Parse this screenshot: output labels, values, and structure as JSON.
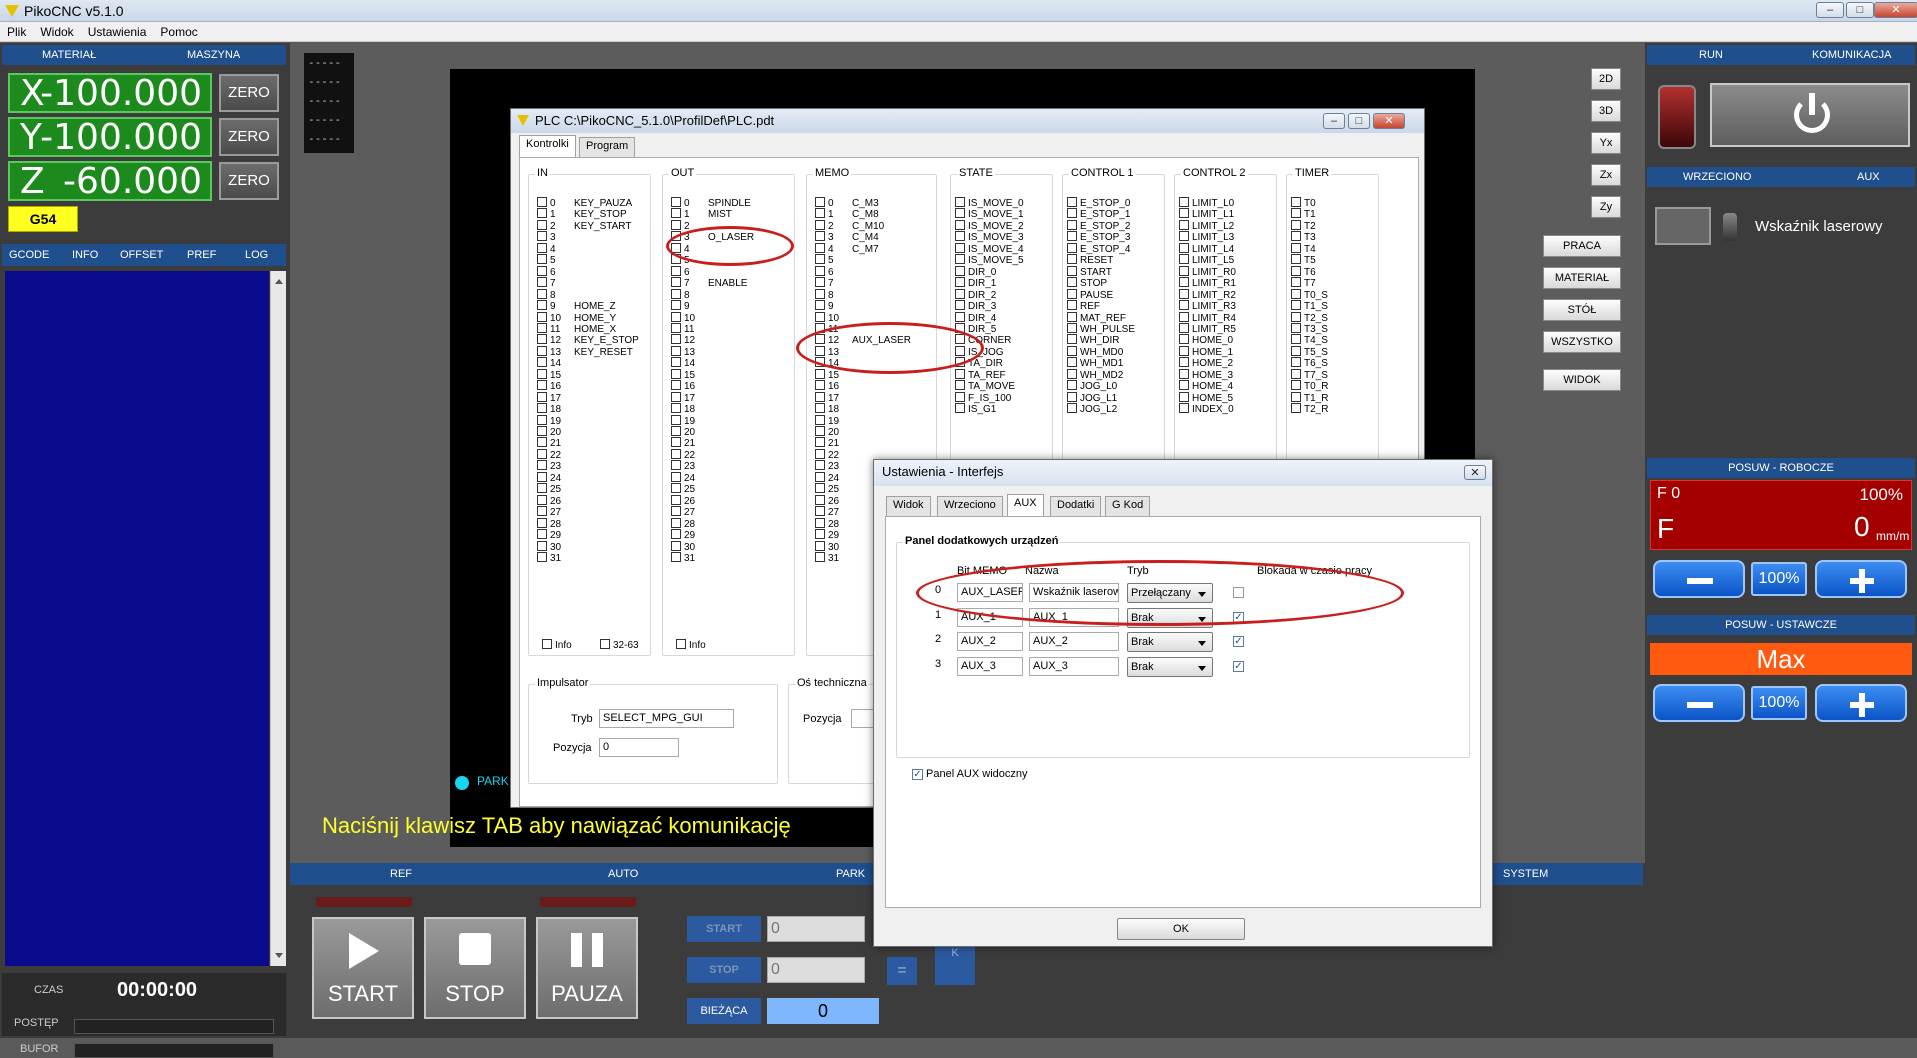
{
  "app": {
    "title": "PikoCNC v5.1.0",
    "menu": [
      "Plik",
      "Widok",
      "Ustawienia",
      "Pomoc"
    ]
  },
  "dro": {
    "hdr_left": "MATERIAŁ",
    "hdr_right": "MASZYNA",
    "axes": [
      {
        "axis": "X",
        "value": "-100.000"
      },
      {
        "axis": "Y",
        "value": "-100.000"
      },
      {
        "axis": "Z",
        "value": "-60.000"
      }
    ],
    "zero_label": "ZERO",
    "wcs": "G54"
  },
  "left_tabs": [
    "GCODE",
    "INFO",
    "OFFSET",
    "PREF",
    "LOG"
  ],
  "status": {
    "czas_label": "CZAS",
    "czas": "00:00:00",
    "postep_label": "POSTĘP",
    "bufor_label": "BUFOR"
  },
  "viewer": {
    "dashes": [
      "-----",
      "-----",
      "-----",
      "-----",
      "-----"
    ],
    "park": "PARK",
    "message": "Naciśnij klawisz TAB aby nawiązać komunikację"
  },
  "view_buttons": [
    "2D",
    "3D",
    "Yx",
    "Zx",
    "Zy"
  ],
  "side_buttons": [
    "PRACA",
    "MATERIAŁ",
    "STÓŁ",
    "WSZYSTKO",
    "WIDOK"
  ],
  "bottom_bar": {
    "ref": "REF",
    "auto": "AUTO",
    "park": "PARK",
    "system": "SYSTEM",
    "start": "START",
    "stop": "STOP",
    "pauza": "PAUZA",
    "start_field": "START",
    "stop_field": "STOP",
    "start_val": "0",
    "stop_val": "0",
    "eq": "=",
    "k": "K",
    "biezaca": "BIEŻĄCA",
    "biezaca_val": "0"
  },
  "right": {
    "run": "RUN",
    "komunikacja": "KOMUNIKACJA",
    "wrzeciono": "WRZECIONO",
    "aux": "AUX",
    "aux_item": "Wskaźnik laserowy",
    "feed_hdr": "POSUW - ROBOCZE",
    "f0": "F 0",
    "f0_pct": "100%",
    "f": "F",
    "f_val": "0",
    "f_unit": "mm/m",
    "pct": "100%",
    "rapid_hdr": "POSUW - USTAWCZE",
    "rapid_val": "Max"
  },
  "plc": {
    "title": "PLC C:\\PikoCNC_5.1.0\\ProfilDef\\PLC.pdt",
    "tabs": [
      "Kontrolki",
      "Program"
    ],
    "groups": {
      "in": "IN",
      "out": "OUT",
      "memo": "MEMO",
      "state": "STATE",
      "control1": "CONTROL 1",
      "control2": "CONTROL 2",
      "timer": "TIMER"
    },
    "in_names": {
      "0": "KEY_PAUZA",
      "1": "KEY_STOP",
      "2": "KEY_START",
      "9": "HOME_Z",
      "10": "HOME_Y",
      "11": "HOME_X",
      "12": "KEY_E_STOP",
      "13": "KEY_RESET"
    },
    "out_names": {
      "0": "SPINDLE",
      "1": "MIST",
      "3": "O_LASER",
      "7": "ENABLE"
    },
    "memo_names": {
      "0": "C_M3",
      "1": "C_M8",
      "2": "C_M10",
      "3": "C_M4",
      "4": "C_M7",
      "12": "AUX_LASER"
    },
    "state": [
      "IS_MOVE_0",
      "IS_MOVE_1",
      "IS_MOVE_2",
      "IS_MOVE_3",
      "IS_MOVE_4",
      "IS_MOVE_5",
      "DIR_0",
      "DIR_1",
      "DIR_2",
      "DIR_3",
      "DIR_4",
      "DIR_5",
      "CORNER",
      "IS_JOG",
      "TA_DIR",
      "TA_REF",
      "TA_MOVE",
      "F_IS_100",
      "IS_G1"
    ],
    "control1": [
      "E_STOP_0",
      "E_STOP_1",
      "E_STOP_2",
      "E_STOP_3",
      "E_STOP_4",
      "RESET",
      "START",
      "STOP",
      "PAUSE",
      "REF",
      "MAT_REF",
      "WH_PULSE",
      "WH_DIR",
      "WH_MD0",
      "WH_MD1",
      "WH_MD2",
      "JOG_L0",
      "JOG_L1",
      "JOG_L2"
    ],
    "control2": [
      "LIMIT_L0",
      "LIMIT_L1",
      "LIMIT_L2",
      "LIMIT_L3",
      "LIMIT_L4",
      "LIMIT_L5",
      "LIMIT_R0",
      "LIMIT_R1",
      "LIMIT_R2",
      "LIMIT_R3",
      "LIMIT_R4",
      "LIMIT_R5",
      "HOME_0",
      "HOME_1",
      "HOME_2",
      "HOME_3",
      "HOME_4",
      "HOME_5",
      "INDEX_0"
    ],
    "timer": [
      "T0",
      "T1",
      "T2",
      "T3",
      "T4",
      "T5",
      "T6",
      "T7",
      "T0_S",
      "T1_S",
      "T2_S",
      "T3_S",
      "T4_S",
      "T5_S",
      "T6_S",
      "T7_S",
      "T0_R",
      "T1_R",
      "T2_R"
    ],
    "info": "Info",
    "range": "32-63",
    "impulsator": "Impulsator",
    "tryb_label": "Tryb",
    "tryb_val": "SELECT_MPG_GUI",
    "pozycja_label": "Pozycja",
    "pozycja_val": "0",
    "os": "Oś techniczna",
    "os_pozycja": "Pozycja"
  },
  "dlg": {
    "title": "Ustawienia - Interfejs",
    "tabs": [
      "Widok",
      "Wrzeciono",
      "AUX",
      "Dodatki",
      "G Kod"
    ],
    "group": "Panel dodatkowych urządzeń",
    "cols": [
      "Bit MEMO",
      "Nazwa",
      "Tryb",
      "Blokada w czasie pracy"
    ],
    "rows": [
      {
        "idx": "0",
        "bit": "AUX_LASER",
        "name": "Wskaźnik laserowy",
        "mode": "Przełączany",
        "lock": false
      },
      {
        "idx": "1",
        "bit": "AUX_1",
        "name": "AUX_1",
        "mode": "Brak",
        "lock": true
      },
      {
        "idx": "2",
        "bit": "AUX_2",
        "name": "AUX_2",
        "mode": "Brak",
        "lock": true
      },
      {
        "idx": "3",
        "bit": "AUX_3",
        "name": "AUX_3",
        "mode": "Brak",
        "lock": true
      }
    ],
    "visible": "Panel AUX widoczny",
    "ok": "OK"
  }
}
